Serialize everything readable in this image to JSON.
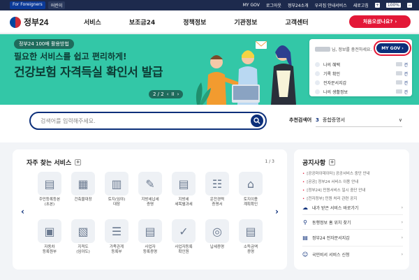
{
  "topbar": {
    "foreigners": "For Foreigners",
    "child": "어린이",
    "links": [
      "MY GOV",
      "로그아웃",
      "정부24소개",
      "우리집 안내서비스",
      "새로고침"
    ],
    "zoom": "100%"
  },
  "header": {
    "logo": "정부24",
    "nav": [
      "서비스",
      "보조금24",
      "정책정보",
      "기관정보",
      "고객센터"
    ],
    "first_visit_button": "처음오셨나요?"
  },
  "banner": {
    "tag": "정부24 100배 활용방법",
    "line1": "필요한 서비스를 쉽고 편리하게!",
    "line2": "건강보험 자격득실 확인서 발급",
    "pager": "2 / 2",
    "pager_prev": "‹",
    "pager_pause": "II",
    "pager_next": "›"
  },
  "mygov": {
    "greeting": "님, 정보를 충전하세요.",
    "button": "MY GOV",
    "rows": [
      {
        "label": "나의 혜택",
        "count": "건"
      },
      {
        "label": "기록 확인",
        "count": "건"
      },
      {
        "label": "전자문서지갑",
        "count": "건"
      },
      {
        "label": "나의 생활정보",
        "count": "건"
      }
    ]
  },
  "search": {
    "placeholder": "검색어를 입력해주세요.",
    "keyword_label": "추천검색어",
    "keyword_num": "3",
    "keyword_text": "종합증명서",
    "arrow": "∨"
  },
  "services": {
    "title": "자주 찾는 서비스",
    "plus": "+",
    "page": "1 / 3",
    "prev": "‹",
    "next": "›",
    "items": [
      {
        "label": "주민등록등본\n(초본)"
      },
      {
        "label": "건축물대장"
      },
      {
        "label": "토지(임야)\n대장"
      },
      {
        "label": "지방세납세\n증명"
      },
      {
        "label": "지방세\n세목별과세"
      },
      {
        "label": "운전경력\n증명서"
      },
      {
        "label": "토지이용\n계획확인"
      },
      {
        "label": "자동차\n등록원부"
      },
      {
        "label": "지적도\n(임야도)"
      },
      {
        "label": "가족관계\n등록부"
      },
      {
        "label": "사업자\n등록증명"
      },
      {
        "label": "사업자등록\n확인원"
      },
      {
        "label": "납세증명"
      },
      {
        "label": "소득금액\n증명"
      }
    ]
  },
  "notices": {
    "title": "공지사항",
    "plus": "+",
    "items": [
      "[공공마이데이터] 공공서비스 중단 안내",
      "[공공] 정부24 서비스 이용 안내",
      "[정부24] 민원서비스 일시 중단 안내",
      "[전자정부] 민원 처리 관련 공지"
    ]
  },
  "quicklinks": [
    {
      "label": "내가 받은 서비스 바로가기"
    },
    {
      "label": "동행정보 홈 위치 찾기"
    },
    {
      "label": "정부24 전자문서지갑"
    },
    {
      "label": "국민비서 서비스 신청"
    }
  ],
  "colors": {
    "brand_navy": "#0c2f7a",
    "accent_red": "#e31837",
    "banner_green": "#33c7a7"
  }
}
